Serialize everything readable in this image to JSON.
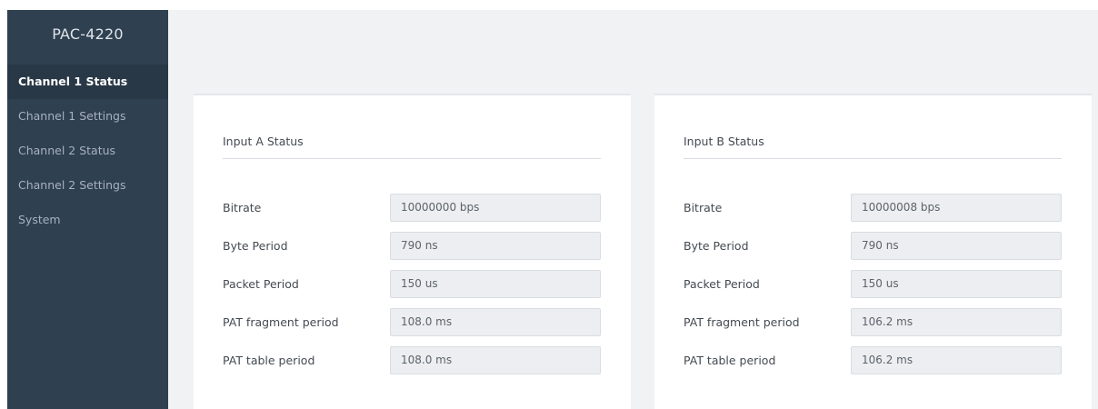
{
  "app": {
    "title": "PAC-4220"
  },
  "sidebar": {
    "items": [
      {
        "label": "Channel 1 Status",
        "active": true
      },
      {
        "label": "Channel 1 Settings",
        "active": false
      },
      {
        "label": "Channel 2 Status",
        "active": false
      },
      {
        "label": "Channel 2 Settings",
        "active": false
      },
      {
        "label": "System",
        "active": false
      }
    ]
  },
  "panels": [
    {
      "title": "Input A Status",
      "rows": [
        {
          "label": "Bitrate",
          "value": "10000000 bps"
        },
        {
          "label": "Byte Period",
          "value": "790 ns"
        },
        {
          "label": "Packet Period",
          "value": "150 us"
        },
        {
          "label": "PAT fragment period",
          "value": "108.0 ms"
        },
        {
          "label": "PAT table period",
          "value": "108.0 ms"
        }
      ]
    },
    {
      "title": "Input B Status",
      "rows": [
        {
          "label": "Bitrate",
          "value": "10000008 bps"
        },
        {
          "label": "Byte Period",
          "value": "790 ns"
        },
        {
          "label": "Packet Period",
          "value": "150 us"
        },
        {
          "label": "PAT fragment period",
          "value": "106.2 ms"
        },
        {
          "label": "PAT table period",
          "value": "106.2 ms"
        }
      ]
    }
  ],
  "colors": {
    "sidebar_bg": "#2f4050",
    "sidebar_active_bg": "#293846",
    "content_bg": "#f1f2f4",
    "panel_bg": "#ffffff",
    "field_bg": "#eceef1"
  }
}
